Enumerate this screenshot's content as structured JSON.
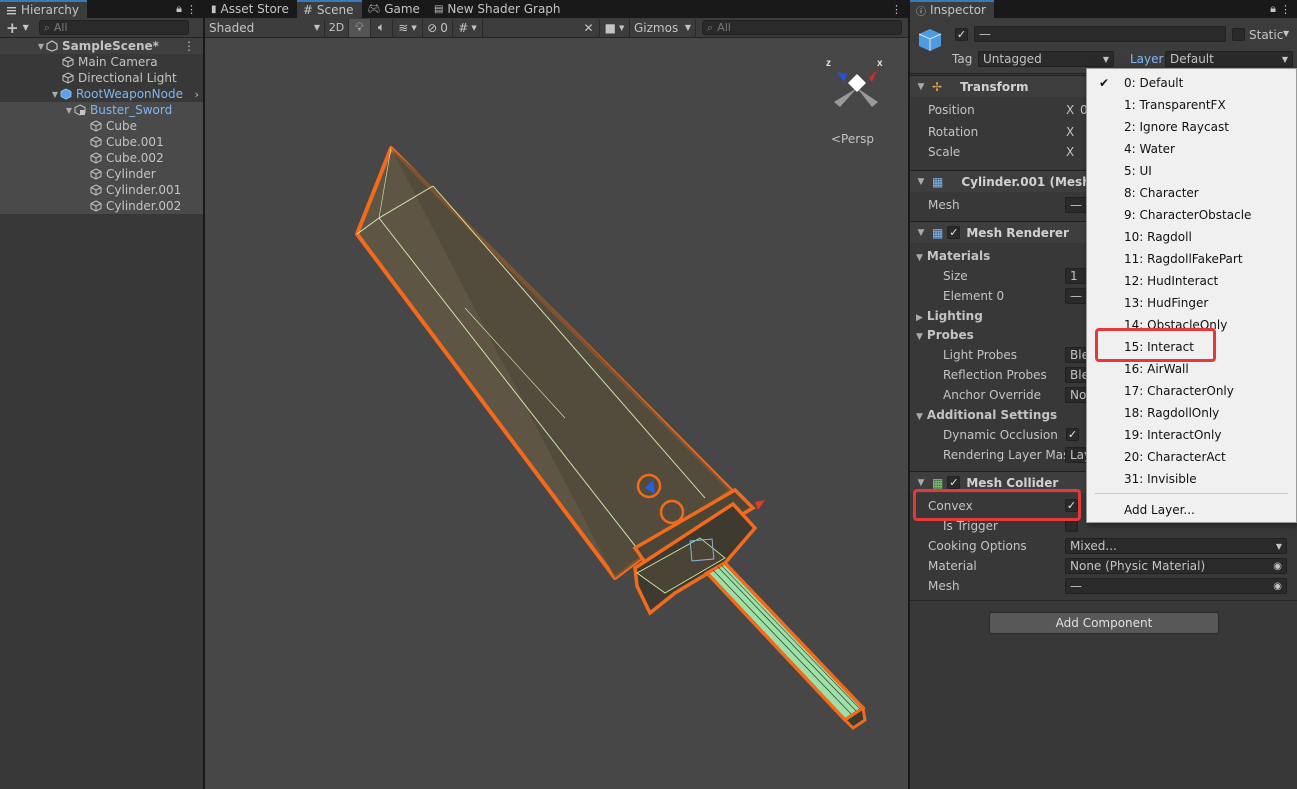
{
  "hierarchy": {
    "tab": "Hierarchy",
    "add_label": "+",
    "search_placeholder": "All",
    "scene_name": "SampleScene*",
    "items": [
      {
        "label": "Main Camera"
      },
      {
        "label": "Directional Light"
      },
      {
        "label": "RootWeaponNode"
      },
      {
        "label": "Buster_Sword"
      },
      {
        "label": "Cube"
      },
      {
        "label": "Cube.001"
      },
      {
        "label": "Cube.002"
      },
      {
        "label": "Cylinder"
      },
      {
        "label": "Cylinder.001"
      },
      {
        "label": "Cylinder.002"
      }
    ]
  },
  "scene": {
    "tabs": [
      "Asset Store",
      "Scene",
      "Game",
      "New Shader Graph"
    ],
    "shading": "Shaded",
    "mode_2d": "2D",
    "hidden_count": "0",
    "gizmos": "Gizmos",
    "search_placeholder": "All",
    "persp_label": "<Persp"
  },
  "inspector": {
    "tab": "Inspector",
    "object_name": "—",
    "static_label": "Static",
    "tag_label": "Tag",
    "tag_value": "Untagged",
    "layer_label": "Layer",
    "layer_value": "Default",
    "transform": {
      "title": "Transform",
      "position": "Position",
      "rotation": "Rotation",
      "scale": "Scale",
      "axis_x": "X",
      "position_x_partial": "0"
    },
    "mesh_filter": {
      "title": "Cylinder.001 (Mesh",
      "mesh_label": "Mesh",
      "mesh_value": "—"
    },
    "mesh_renderer": {
      "title": "Mesh Renderer",
      "materials": "Materials",
      "size_label": "Size",
      "size_value": "1",
      "element0": "Element 0",
      "element0_value": "—",
      "lighting": "Lighting",
      "probes": "Probes",
      "light_probes": "Light Probes",
      "light_probes_value": "Ble",
      "reflection_probes": "Reflection Probes",
      "reflection_probes_value": "Ble",
      "anchor_override": "Anchor Override",
      "anchor_override_value": "Nor",
      "additional": "Additional Settings",
      "dynamic_occlusion": "Dynamic Occlusion",
      "rendering_layer_mask": "Rendering Layer Mas",
      "rendering_layer_value": "Lay"
    },
    "mesh_collider": {
      "title": "Mesh Collider",
      "convex": "Convex",
      "is_trigger": "Is Trigger",
      "cooking_options": "Cooking Options",
      "cooking_value": "Mixed...",
      "material": "Material",
      "material_value": "None (Physic Material)",
      "mesh": "Mesh",
      "mesh_value": "—"
    },
    "add_component": "Add Component"
  },
  "layer_menu": {
    "items": [
      "0: Default",
      "1: TransparentFX",
      "2: Ignore Raycast",
      "4: Water",
      "5: UI",
      "8: Character",
      "9: CharacterObstacle",
      "10: Ragdoll",
      "11: RagdollFakePart",
      "12: HudInteract",
      "13: HudFinger",
      "14: ObstacleOnly",
      "15: Interact",
      "16: AirWall",
      "17: CharacterOnly",
      "18: RagdollOnly",
      "19: InteractOnly",
      "20: CharacterAct",
      "31: Invisible"
    ],
    "add_layer": "Add Layer...",
    "selected": "0: Default",
    "highlighted": "15: Interact"
  },
  "colors": {
    "selection_outline": "#f26b1d",
    "highlight_box": "#e5383a",
    "accent_blue": "#3a79bb"
  }
}
